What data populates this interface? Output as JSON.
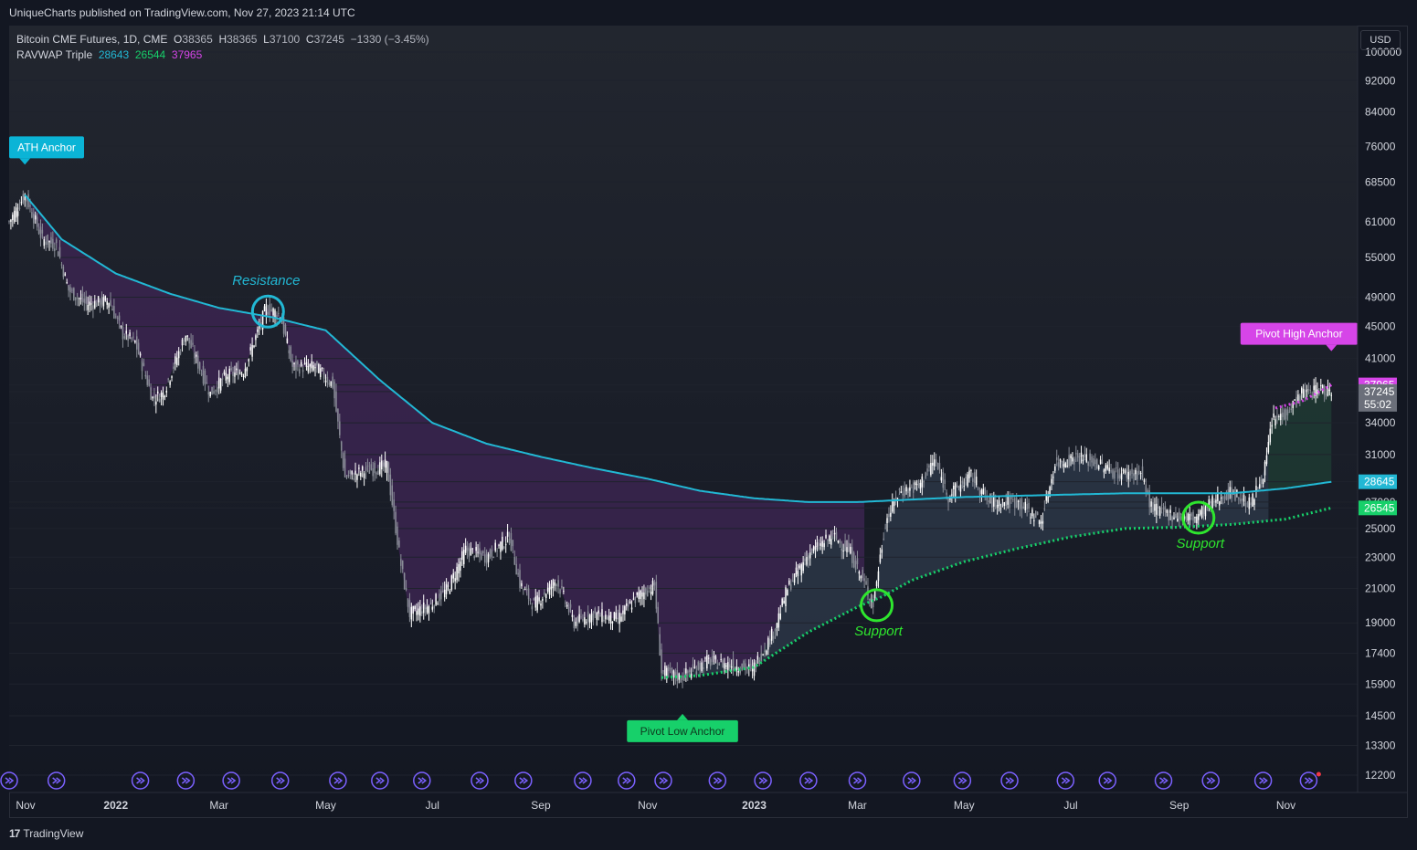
{
  "header": {
    "publisher": "UniqueCharts published on TradingView.com, Nov 27, 2023 21:14 UTC"
  },
  "legend": {
    "symbol": "Bitcoin CME Futures, 1D, CME",
    "o_label": "O",
    "o_value": "38365",
    "h_label": "H",
    "h_value": "38365",
    "l_label": "L",
    "l_value": "37100",
    "c_label": "C",
    "c_value": "37245",
    "change": "−1330 (−3.45%)",
    "indicator": "RAVWAP Triple",
    "v1": "28643",
    "v2": "26544",
    "v3": "37965"
  },
  "currency_button": "USD",
  "footer": {
    "brand": "TradingView",
    "logo": "tv-logo-icon"
  },
  "colors": {
    "background": "#131722",
    "cyan": "#22b8d4",
    "green": "#17d06a",
    "magenta": "#d645e8",
    "purple_fill": "#3b2450",
    "slate_fill": "#2c3646",
    "green_fill": "#1e3a33",
    "up_candle": "#ffffff",
    "down_candle": "#8a8e98",
    "support_circle": "#2ee52e"
  },
  "chart_data": {
    "type": "candlestick",
    "scale": "log",
    "ylim": [
      11600,
      108000
    ],
    "xlim": [
      "2021-11-01",
      "2023-12-12"
    ],
    "y_ticks": [
      "100000",
      "92000",
      "84000",
      "76000",
      "68500",
      "61000",
      "55000",
      "49000",
      "45000",
      "41000",
      "37965",
      "37245",
      "34000",
      "31000",
      "28645",
      "27000",
      "26545",
      "25000",
      "23000",
      "21000",
      "19000",
      "17400",
      "15900",
      "14500",
      "13300",
      "12200"
    ],
    "x_ticks": [
      {
        "label": "Nov",
        "date": "2021-11-01"
      },
      {
        "label": "2022",
        "date": "2022-01-01"
      },
      {
        "label": "Mar",
        "date": "2022-03-01"
      },
      {
        "label": "May",
        "date": "2022-05-01"
      },
      {
        "label": "Jul",
        "date": "2022-07-01"
      },
      {
        "label": "Sep",
        "date": "2022-09-01"
      },
      {
        "label": "Nov",
        "date": "2022-11-01"
      },
      {
        "label": "2023",
        "date": "2023-01-01"
      },
      {
        "label": "Mar",
        "date": "2023-03-01"
      },
      {
        "label": "May",
        "date": "2023-05-01"
      },
      {
        "label": "Jul",
        "date": "2023-07-01"
      },
      {
        "label": "Sep",
        "date": "2023-09-01"
      },
      {
        "label": "Nov",
        "date": "2023-11-01"
      }
    ],
    "price_path": [
      [
        "2021-11-01",
        61000
      ],
      [
        "2021-11-10",
        66000
      ],
      [
        "2021-11-20",
        58000
      ],
      [
        "2021-11-28",
        57000
      ],
      [
        "2021-12-05",
        50000
      ],
      [
        "2021-12-15",
        48000
      ],
      [
        "2021-12-28",
        48500
      ],
      [
        "2022-01-05",
        44000
      ],
      [
        "2022-01-12",
        43000
      ],
      [
        "2022-01-22",
        36500
      ],
      [
        "2022-01-28",
        37000
      ],
      [
        "2022-02-10",
        44000
      ],
      [
        "2022-02-24",
        37000
      ],
      [
        "2022-03-05",
        39000
      ],
      [
        "2022-03-15",
        39500
      ],
      [
        "2022-03-28",
        47500
      ],
      [
        "2022-04-05",
        46500
      ],
      [
        "2022-04-12",
        40000
      ],
      [
        "2022-04-25",
        40000
      ],
      [
        "2022-05-05",
        38000
      ],
      [
        "2022-05-12",
        29000
      ],
      [
        "2022-05-22",
        29500
      ],
      [
        "2022-06-05",
        30000
      ],
      [
        "2022-06-13",
        22500
      ],
      [
        "2022-06-18",
        19500
      ],
      [
        "2022-06-30",
        20000
      ],
      [
        "2022-07-10",
        21000
      ],
      [
        "2022-07-20",
        23500
      ],
      [
        "2022-08-01",
        23000
      ],
      [
        "2022-08-14",
        24400
      ],
      [
        "2022-08-20",
        21300
      ],
      [
        "2022-08-28",
        20000
      ],
      [
        "2022-09-10",
        21500
      ],
      [
        "2022-09-20",
        19000
      ],
      [
        "2022-10-01",
        19500
      ],
      [
        "2022-10-15",
        19200
      ],
      [
        "2022-10-26",
        20500
      ],
      [
        "2022-11-05",
        21200
      ],
      [
        "2022-11-09",
        16500
      ],
      [
        "2022-11-20",
        16200
      ],
      [
        "2022-12-05",
        17000
      ],
      [
        "2022-12-20",
        16800
      ],
      [
        "2022-12-31",
        16600
      ],
      [
        "2023-01-12",
        18500
      ],
      [
        "2023-01-20",
        21000
      ],
      [
        "2023-02-01",
        23200
      ],
      [
        "2023-02-15",
        24500
      ],
      [
        "2023-02-25",
        23300
      ],
      [
        "2023-03-10",
        20100
      ],
      [
        "2023-03-17",
        25500
      ],
      [
        "2023-03-25",
        27800
      ],
      [
        "2023-04-05",
        28300
      ],
      [
        "2023-04-14",
        30500
      ],
      [
        "2023-04-22",
        27500
      ],
      [
        "2023-05-05",
        29200
      ],
      [
        "2023-05-15",
        27000
      ],
      [
        "2023-06-01",
        27000
      ],
      [
        "2023-06-14",
        25500
      ],
      [
        "2023-06-22",
        30200
      ],
      [
        "2023-07-05",
        30800
      ],
      [
        "2023-07-15",
        30300
      ],
      [
        "2023-07-28",
        29300
      ],
      [
        "2023-08-10",
        29400
      ],
      [
        "2023-08-16",
        26600
      ],
      [
        "2023-08-25",
        26100
      ],
      [
        "2023-09-01",
        25900
      ],
      [
        "2023-09-10",
        25800
      ],
      [
        "2023-09-20",
        27000
      ],
      [
        "2023-10-01",
        27800
      ],
      [
        "2023-10-12",
        26800
      ],
      [
        "2023-10-20",
        29800
      ],
      [
        "2023-10-24",
        34200
      ],
      [
        "2023-11-01",
        35000
      ],
      [
        "2023-11-10",
        37000
      ],
      [
        "2023-11-20",
        37500
      ],
      [
        "2023-11-27",
        37245
      ]
    ],
    "series": [
      {
        "name": "RAVWAP Triple (ATH anchor)",
        "color": "#22b8d4",
        "start": "2021-11-10",
        "value": 28643,
        "points": [
          [
            "2021-11-10",
            66000
          ],
          [
            "2021-12-01",
            58000
          ],
          [
            "2022-01-01",
            52500
          ],
          [
            "2022-02-01",
            49500
          ],
          [
            "2022-03-01",
            47500
          ],
          [
            "2022-04-01",
            46200
          ],
          [
            "2022-05-01",
            44500
          ],
          [
            "2022-06-01",
            38500
          ],
          [
            "2022-07-01",
            34000
          ],
          [
            "2022-08-01",
            32000
          ],
          [
            "2022-09-01",
            30800
          ],
          [
            "2022-10-01",
            29800
          ],
          [
            "2022-11-01",
            28900
          ],
          [
            "2022-12-01",
            27900
          ],
          [
            "2023-01-01",
            27300
          ],
          [
            "2023-02-01",
            27000
          ],
          [
            "2023-03-01",
            27000
          ],
          [
            "2023-04-01",
            27200
          ],
          [
            "2023-05-01",
            27400
          ],
          [
            "2023-06-01",
            27500
          ],
          [
            "2023-07-01",
            27600
          ],
          [
            "2023-08-01",
            27700
          ],
          [
            "2023-09-01",
            27700
          ],
          [
            "2023-10-01",
            27700
          ],
          [
            "2023-11-01",
            28100
          ],
          [
            "2023-11-27",
            28643
          ]
        ]
      },
      {
        "name": "RAVWAP Triple (Pivot Low anchor)",
        "color": "#17d06a",
        "start": "2022-11-09",
        "value": 26544,
        "points": [
          [
            "2022-11-09",
            16200
          ],
          [
            "2022-12-01",
            16300
          ],
          [
            "2023-01-01",
            16700
          ],
          [
            "2023-02-01",
            18500
          ],
          [
            "2023-03-01",
            19900
          ],
          [
            "2023-03-15",
            20500
          ],
          [
            "2023-04-01",
            21500
          ],
          [
            "2023-05-01",
            22700
          ],
          [
            "2023-06-01",
            23600
          ],
          [
            "2023-07-01",
            24400
          ],
          [
            "2023-08-01",
            25000
          ],
          [
            "2023-09-01",
            25100
          ],
          [
            "2023-10-01",
            25300
          ],
          [
            "2023-11-01",
            25700
          ],
          [
            "2023-11-27",
            26544
          ]
        ]
      },
      {
        "name": "RAVWAP Triple (Pivot High anchor)",
        "color": "#d645e8",
        "start": "2023-11-01",
        "value": 37965,
        "points": [
          [
            "2023-10-26",
            35500
          ],
          [
            "2023-11-10",
            36200
          ],
          [
            "2023-11-27",
            37965
          ]
        ]
      }
    ],
    "price_labels": [
      {
        "value": 37965,
        "text": "37965",
        "color": "#d645e8"
      },
      {
        "value": 37245,
        "text": "37245",
        "sub": "55:02",
        "color": "#6b6f7a"
      },
      {
        "value": 28645,
        "text": "28645",
        "color": "#22b8d4"
      },
      {
        "value": 26545,
        "text": "26545",
        "color": "#17d06a"
      }
    ],
    "anchors": [
      {
        "text": "ATH Anchor",
        "date": "2021-11-10",
        "value": 66000,
        "color": "#0bb4d6"
      },
      {
        "text": "Pivot Low Anchor",
        "date": "2022-11-21",
        "value": 15500,
        "color": "#17d06a"
      },
      {
        "text": "Pivot High Anchor",
        "date": "2023-11-27",
        "value": 38365,
        "color": "#d645e8"
      }
    ],
    "annotations": [
      {
        "text": "Resistance",
        "date": "2022-03-29",
        "value": 47000,
        "color": "#22b8d4"
      },
      {
        "text": "Support",
        "date": "2023-03-12",
        "value": 20000,
        "color": "#2ee52e"
      },
      {
        "text": "Support",
        "date": "2023-09-12",
        "value": 25800,
        "color": "#2ee52e"
      }
    ],
    "events": [
      "2021-11-01",
      "2021-11-28",
      "2022-01-15",
      "2022-02-10",
      "2022-03-08",
      "2022-04-05",
      "2022-05-08",
      "2022-06-01",
      "2022-06-25",
      "2022-07-28",
      "2022-08-22",
      "2022-09-25",
      "2022-10-20",
      "2022-11-10",
      "2022-12-11",
      "2023-01-06",
      "2023-02-01",
      "2023-03-01",
      "2023-04-01",
      "2023-04-30",
      "2023-05-27",
      "2023-06-28",
      "2023-07-22",
      "2023-08-23",
      "2023-09-19",
      "2023-10-19",
      "2023-11-14"
    ]
  }
}
